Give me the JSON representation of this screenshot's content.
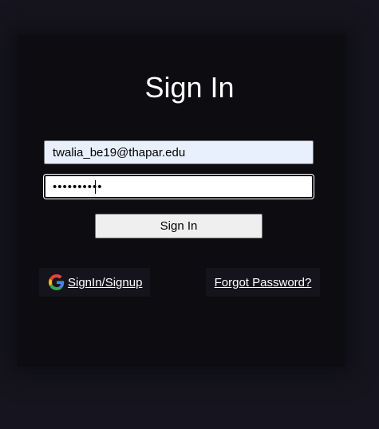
{
  "login": {
    "title": "Sign In",
    "email_value": "twalia_be19@thapar.edu",
    "password_value": "••••••••••",
    "submit_label": "Sign In",
    "google_link_label": "SignIn/Signup",
    "forgot_link_label": "Forgot Password?"
  },
  "icons": {
    "google": "google-icon"
  },
  "colors": {
    "page_background": "#16151f",
    "card_background": "#0c0c11",
    "autofill_background": "#e8f0fe",
    "link_box_background": "#15141d"
  }
}
